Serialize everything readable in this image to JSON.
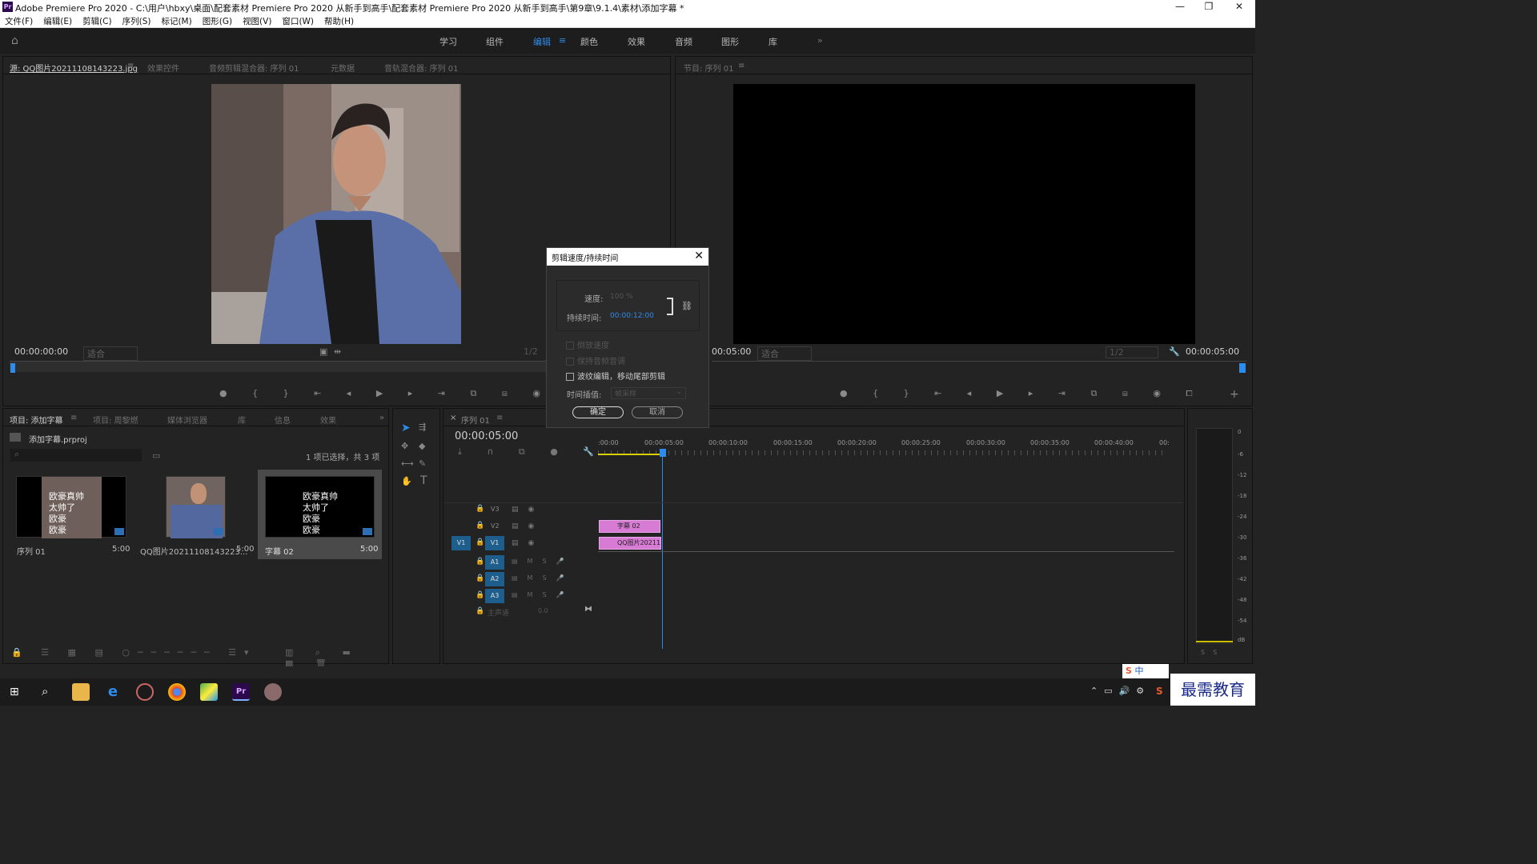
{
  "window": {
    "title": "Adobe Premiere Pro 2020 - C:\\用户\\hbxy\\桌面\\配套素材 Premiere Pro 2020 从新手到高手\\配套素材 Premiere Pro 2020 从新手到高手\\第9章\\9.1.4\\素材\\添加字幕 *",
    "logo": "Pr",
    "minimize": "—",
    "maximize": "❐",
    "close": "✕"
  },
  "menu": [
    "文件(F)",
    "编辑(E)",
    "剪辑(C)",
    "序列(S)",
    "标记(M)",
    "图形(G)",
    "视图(V)",
    "窗口(W)",
    "帮助(H)"
  ],
  "workspaces": [
    "学习",
    "组件",
    "编辑",
    "颜色",
    "效果",
    "音频",
    "图形",
    "库"
  ],
  "workspace_more": "»",
  "source_panel": {
    "tabs": [
      "源: QQ图片20211108143223.jpg",
      "效果控件",
      "音频剪辑混合器: 序列 01",
      "元数据",
      "音轨混合器: 序列 01"
    ],
    "timecode": "00:00:00:00",
    "fit": "适合",
    "ratio": "1/2"
  },
  "program_panel": {
    "tab": "节目: 序列 01",
    "timecode_left": "00:05:00",
    "fit": "适合",
    "ratio": "1/2",
    "timecode_right": "00:00:05:00"
  },
  "dialog": {
    "title": "剪辑速度/持续时间",
    "speed_label": "速度:",
    "speed_value": "100 %",
    "duration_label": "持续时间:",
    "duration_value": "00:00:12:00",
    "reverse": "倒放速度",
    "keep_pitch": "保持音频音调",
    "ripple": "波纹编辑，移动尾部剪辑",
    "interp_label": "时间插值:",
    "interp_value": "帧采样",
    "ok": "确定",
    "cancel": "取消"
  },
  "project_panel": {
    "tabs": [
      "项目: 添加字幕",
      "项目: 周黎燃",
      "媒体浏览器",
      "库",
      "信息",
      "效果"
    ],
    "project_file": "添加字幕.prproj",
    "selection": "1 项已选择，共 3 项",
    "items": [
      {
        "name": "序列 01",
        "duration": "5:00",
        "caption": [
          "欧豪真帅",
          "太帅了",
          "欧豪",
          "欧豪"
        ]
      },
      {
        "name": "QQ图片20211108143223...",
        "duration": "5:00"
      },
      {
        "name": "字幕 02",
        "duration": "5:00",
        "caption": [
          "欧豪真帅",
          "太帅了",
          "欧豪",
          "欧豪"
        ]
      }
    ]
  },
  "timeline": {
    "tab": "序列 01",
    "timecode": "00:00:05:00",
    "ruler": [
      ":00:00",
      "00:00:05:00",
      "00:00:10:00",
      "00:00:15:00",
      "00:00:20:00",
      "00:00:25:00",
      "00:00:30:00",
      "00:00:35:00",
      "00:00:40:00",
      "00:"
    ],
    "tracks": [
      "V3",
      "V2",
      "V1",
      "A1",
      "A2",
      "A3"
    ],
    "source_v1": "V1",
    "master": "主声道",
    "master_value": "0.0",
    "clip_v2": "字幕 02",
    "clip_v1": "QQ图片202111"
  },
  "meter": [
    "0",
    "-6",
    "-12",
    "-18",
    "-24",
    "-30",
    "-36",
    "-42",
    "-48",
    "-54",
    "dB"
  ],
  "taskbar": {
    "ime": "中",
    "brand": "最需教育"
  }
}
